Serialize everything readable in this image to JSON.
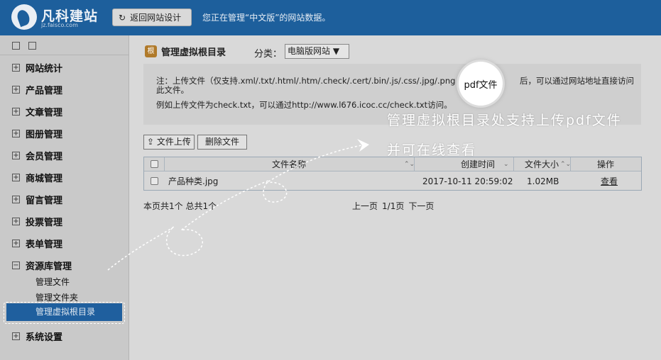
{
  "header": {
    "brand": "凡科建站",
    "brand_sub": "jz.faisco.com",
    "back_button": "返回网站设计",
    "manage_text": "您正在管理“中文版”的网站数据。"
  },
  "sidebar": {
    "items": [
      {
        "label": "网站统计",
        "expander": "+"
      },
      {
        "label": "产品管理",
        "expander": "+"
      },
      {
        "label": "文章管理",
        "expander": "+"
      },
      {
        "label": "图册管理",
        "expander": "+"
      },
      {
        "label": "会员管理",
        "expander": "+"
      },
      {
        "label": "商城管理",
        "expander": "+"
      },
      {
        "label": "留言管理",
        "expander": "+"
      },
      {
        "label": "投票管理",
        "expander": "+"
      },
      {
        "label": "表单管理",
        "expander": "+"
      },
      {
        "label": "资源库管理",
        "expander": "−"
      },
      {
        "label": "系统设置",
        "expander": "+"
      }
    ],
    "sub_items": [
      "管理文件",
      "管理文件夹",
      "管理虚拟根目录"
    ]
  },
  "main": {
    "title": "管理虚拟根目录",
    "title_icon": "根",
    "category_label": "分类：",
    "category_value": "电脑版网站 ▼",
    "note_line1": "注：上传文件（仅支持.xml/.txt/.html/.htm/.check/.cert/.bin/.js/.css/.jpg/.png",
    "note_line1_tail": "后，可以通过网站地址直接访问",
    "note_line2": "此文件。",
    "note_line3": "例如上传文件为check.txt，可以通过http://www.l676.icoc.cc/check.txt访问。",
    "upload_button": "文件上传",
    "delete_button": "删除文件",
    "columns": [
      "文件名称",
      "创建时间",
      "文件大小",
      "操作"
    ],
    "rows": [
      {
        "name": "产品种类.jpg",
        "created": "2017-10-11 20:59:02",
        "size": "1.02MB",
        "action": "查看"
      }
    ],
    "pager_left": "本页共1个 总共1个",
    "pager_prev": "上一页",
    "pager_pages": "1/1页",
    "pager_next": "下一页"
  },
  "annotation": {
    "circle_text": "pdf文件",
    "line1": "管理虚拟根目录处支持上传pdf文件",
    "line2": "并可在线查看"
  }
}
